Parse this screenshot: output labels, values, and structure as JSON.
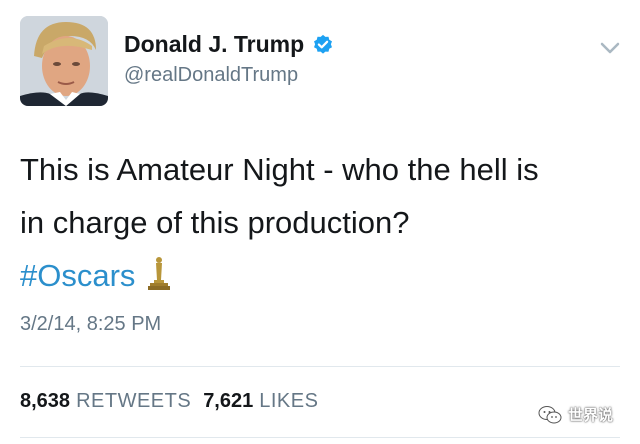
{
  "user": {
    "display_name": "Donald J. Trump",
    "handle": "@realDonaldTrump",
    "verified_icon": "verified-badge-icon",
    "avatar": "profile-photo"
  },
  "tweet": {
    "line1": "This is Amateur Night - who the hell is",
    "line2": "in charge of this production?",
    "hashtag": "#Oscars",
    "emoji_icon": "oscar-statuette-icon",
    "timestamp": "3/2/14, 8:25 PM"
  },
  "stats": {
    "retweets_count": "8,638",
    "retweets_label": "RETWEETS",
    "likes_count": "7,621",
    "likes_label": "LIKES"
  },
  "watermark": {
    "text": "世界说",
    "icon": "wechat-icon"
  },
  "colors": {
    "hashtag": "#2b8fcc",
    "verified": "#1da1f2",
    "secondary_text": "#657786",
    "divider": "#e1e8ed",
    "oscar_gold": "#b8963a"
  }
}
